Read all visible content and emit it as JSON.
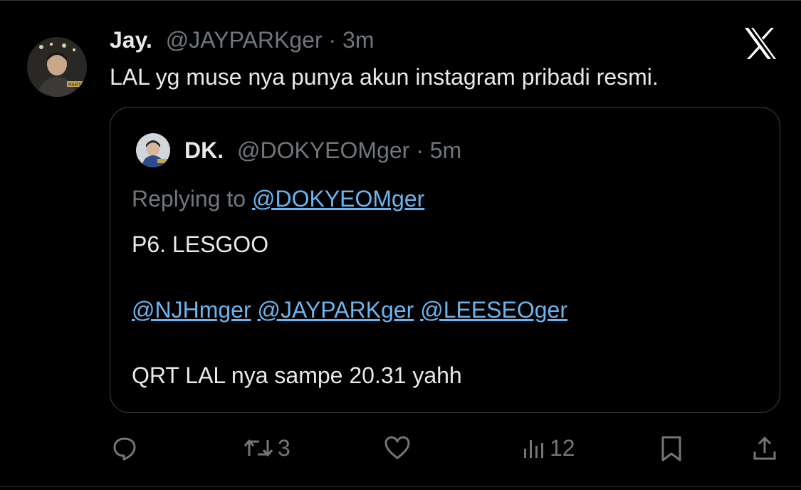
{
  "tweet": {
    "display_name": "Jay.",
    "handle": "@JAYPARKger",
    "separator": "·",
    "time": "3m",
    "text": "LAL yg muse nya punya akun instagram  pribadi resmi."
  },
  "quoted": {
    "display_name": "DK.",
    "handle": "@DOKYEOMger",
    "separator": "·",
    "time": "5m",
    "replying_prefix": "Replying to",
    "replying_handle": "@DOKYEOMger",
    "line1": "P6. LESGOO",
    "mentions": [
      "@NJHmger",
      "@JAYPARKger",
      "@LEESEOger"
    ],
    "line3": "QRT LAL nya sampe 20.31 yahh"
  },
  "actions": {
    "reply_icon": "reply-icon",
    "retweet_count": "3",
    "like_icon": "heart-icon",
    "views_count": "12",
    "bookmark_icon": "bookmark-icon",
    "share_icon": "share-icon"
  },
  "colors": {
    "background": "#000000",
    "text": "#e7e9ea",
    "muted": "#71767b",
    "link": "#6cb4ee",
    "border": "#3e4144"
  }
}
